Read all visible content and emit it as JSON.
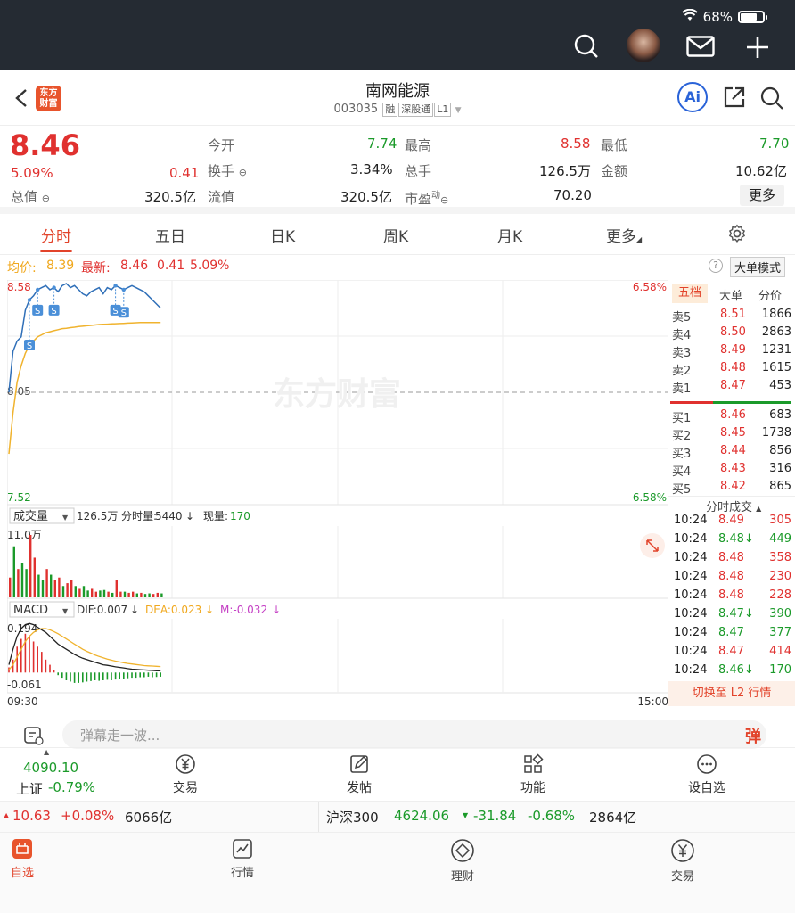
{
  "status": {
    "battery": "68%"
  },
  "header": {
    "logo_text": "东方财富",
    "title": "南网能源",
    "code": "003035",
    "tags": [
      "融",
      "深股通",
      "L1"
    ],
    "ai_label": "Ai"
  },
  "quote": {
    "price": "8.46",
    "change_pct": "5.09%",
    "change": "0.41",
    "total_value_label": "总值",
    "total_value": "320.5亿",
    "open_label": "今开",
    "open": "7.74",
    "turnover_label": "换手",
    "turnover": "3.34%",
    "float_label": "流值",
    "float": "320.5亿",
    "high_label": "最高",
    "high": "8.58",
    "volume_label": "总手",
    "volume": "126.5万",
    "pe_label": "市盈",
    "pe_sup": "动",
    "pe": "70.20",
    "low_label": "最低",
    "low": "7.70",
    "amount_label": "金额",
    "amount": "10.62亿",
    "more": "更多"
  },
  "tabs": [
    "分时",
    "五日",
    "日K",
    "周K",
    "月K",
    "更多"
  ],
  "pricebar": {
    "avg_label": "均价:",
    "avg": "8.39",
    "last_label": "最新:",
    "last": "8.46",
    "chg": "0.41",
    "pct": "5.09%",
    "big_order": "大单模式"
  },
  "chart": {
    "y_high": "8.58",
    "y_mid": "8.05",
    "y_low": "7.52",
    "pct_high": "6.58%",
    "pct_low": "-6.58%",
    "watermark": "东方财富",
    "vol_label": "成交量",
    "vol_info_total": "126.5万",
    "vol_info_fsl_label": "分时量:",
    "vol_info_fsl": "5440",
    "vol_info_xl_label": "现量:",
    "vol_info_xl": "170",
    "vol_max": "11.0万",
    "macd_label": "MACD",
    "dif": "DIF:0.007",
    "dea": "DEA:0.023",
    "m": "M:-0.032",
    "macd_high": "0.194",
    "macd_low": "-0.061",
    "t_start": "09:30",
    "t_end": "15:00",
    "s_marker": "S",
    "price_series": [
      8.05,
      8.25,
      8.3,
      8.32,
      8.45,
      8.5,
      8.52,
      8.55,
      8.56,
      8.57,
      8.55,
      8.56,
      8.54,
      8.57,
      8.58,
      8.56,
      8.57,
      8.55,
      8.53,
      8.52,
      8.54,
      8.55,
      8.56,
      8.53,
      8.56,
      8.55,
      8.57,
      8.56,
      8.55,
      8.56,
      8.57,
      8.56,
      8.55,
      8.54,
      8.52,
      8.5,
      8.48,
      8.46
    ],
    "avg_series": [
      7.75,
      7.95,
      8.1,
      8.18,
      8.24,
      8.28,
      8.3,
      8.32,
      8.33,
      8.34,
      8.345,
      8.35,
      8.355,
      8.36,
      8.362,
      8.365,
      8.367,
      8.37,
      8.372,
      8.374,
      8.376,
      8.378,
      8.38,
      8.381,
      8.382,
      8.383,
      8.384,
      8.385,
      8.386,
      8.387,
      8.388,
      8.389,
      8.39,
      8.39,
      8.39,
      8.39,
      8.39,
      8.39
    ],
    "vol_series": [
      3.5,
      9,
      5,
      6,
      5,
      11,
      7,
      4,
      3,
      5,
      4,
      3,
      3.5,
      2,
      2.5,
      3,
      2,
      1.5,
      2,
      1.2,
      1.5,
      1,
      1.2,
      1.3,
      1,
      0.8,
      3,
      1,
      1,
      0.8,
      1,
      0.7,
      0.8,
      0.6,
      0.7,
      0.6,
      0.8,
      0.7
    ],
    "macd_bars": [
      0.02,
      0.05,
      0.1,
      0.13,
      0.15,
      0.14,
      0.12,
      0.1,
      0.08,
      0.05,
      0.03,
      0.01,
      -0.01,
      -0.02,
      -0.03,
      -0.035,
      -0.04,
      -0.04,
      -0.038,
      -0.035,
      -0.033,
      -0.03,
      -0.032,
      -0.03,
      -0.028,
      -0.03,
      -0.027,
      -0.025,
      -0.024,
      -0.022,
      -0.02,
      -0.02,
      -0.018,
      -0.018,
      -0.016,
      -0.018,
      -0.017,
      -0.016
    ]
  },
  "book": {
    "tabs": [
      "五档",
      "大单",
      "分价"
    ],
    "asks": [
      {
        "label": "卖5",
        "price": "8.51",
        "vol": "1866"
      },
      {
        "label": "卖4",
        "price": "8.50",
        "vol": "2863"
      },
      {
        "label": "卖3",
        "price": "8.49",
        "vol": "1231"
      },
      {
        "label": "卖2",
        "price": "8.48",
        "vol": "1615"
      },
      {
        "label": "卖1",
        "price": "8.47",
        "vol": "453"
      }
    ],
    "bids": [
      {
        "label": "买1",
        "price": "8.46",
        "vol": "683"
      },
      {
        "label": "买2",
        "price": "8.45",
        "vol": "1738"
      },
      {
        "label": "买3",
        "price": "8.44",
        "vol": "856"
      },
      {
        "label": "买4",
        "price": "8.43",
        "vol": "316"
      },
      {
        "label": "买5",
        "price": "8.42",
        "vol": "865"
      }
    ],
    "ticks_title": "分时成交",
    "ticks": [
      {
        "t": "10:24",
        "p": "8.49",
        "v": "305",
        "c": "red",
        "a": ""
      },
      {
        "t": "10:24",
        "p": "8.48",
        "v": "449",
        "c": "grn",
        "a": "↓"
      },
      {
        "t": "10:24",
        "p": "8.48",
        "v": "358",
        "c": "red",
        "a": ""
      },
      {
        "t": "10:24",
        "p": "8.48",
        "v": "230",
        "c": "red",
        "a": ""
      },
      {
        "t": "10:24",
        "p": "8.48",
        "v": "228",
        "c": "red",
        "a": ""
      },
      {
        "t": "10:24",
        "p": "8.47",
        "v": "390",
        "c": "grn",
        "a": "↓"
      },
      {
        "t": "10:24",
        "p": "8.47",
        "v": "377",
        "c": "grn",
        "a": ""
      },
      {
        "t": "10:24",
        "p": "8.47",
        "v": "414",
        "c": "red",
        "a": ""
      },
      {
        "t": "10:24",
        "p": "8.46",
        "v": "170",
        "c": "grn",
        "a": "↓"
      }
    ],
    "switch_l2": "切换至 L2 行情"
  },
  "danmu": {
    "placeholder": "弹幕走一波...",
    "btn": "弹"
  },
  "bottom": {
    "index_value": "4090.10",
    "index_name": "上证",
    "index_pct": "-0.79%",
    "items": [
      "交易",
      "发帖",
      "功能",
      "设自选"
    ]
  },
  "ticker": {
    "a_val": "10.63",
    "a_pct": "+0.08%",
    "a_amt": "6066亿",
    "b_name": "沪深300",
    "b_val": "4624.06",
    "b_chg": "-31.84",
    "b_pct": "-0.68%",
    "b_amt": "2864亿"
  },
  "nav": [
    "自选",
    "行情",
    "理财",
    "交易"
  ],
  "colors": {
    "red": "#e0312f",
    "green": "#1b9a2a",
    "accent": "#e2432a",
    "line": "#2f6fb8",
    "avg": "#f0b32e"
  }
}
